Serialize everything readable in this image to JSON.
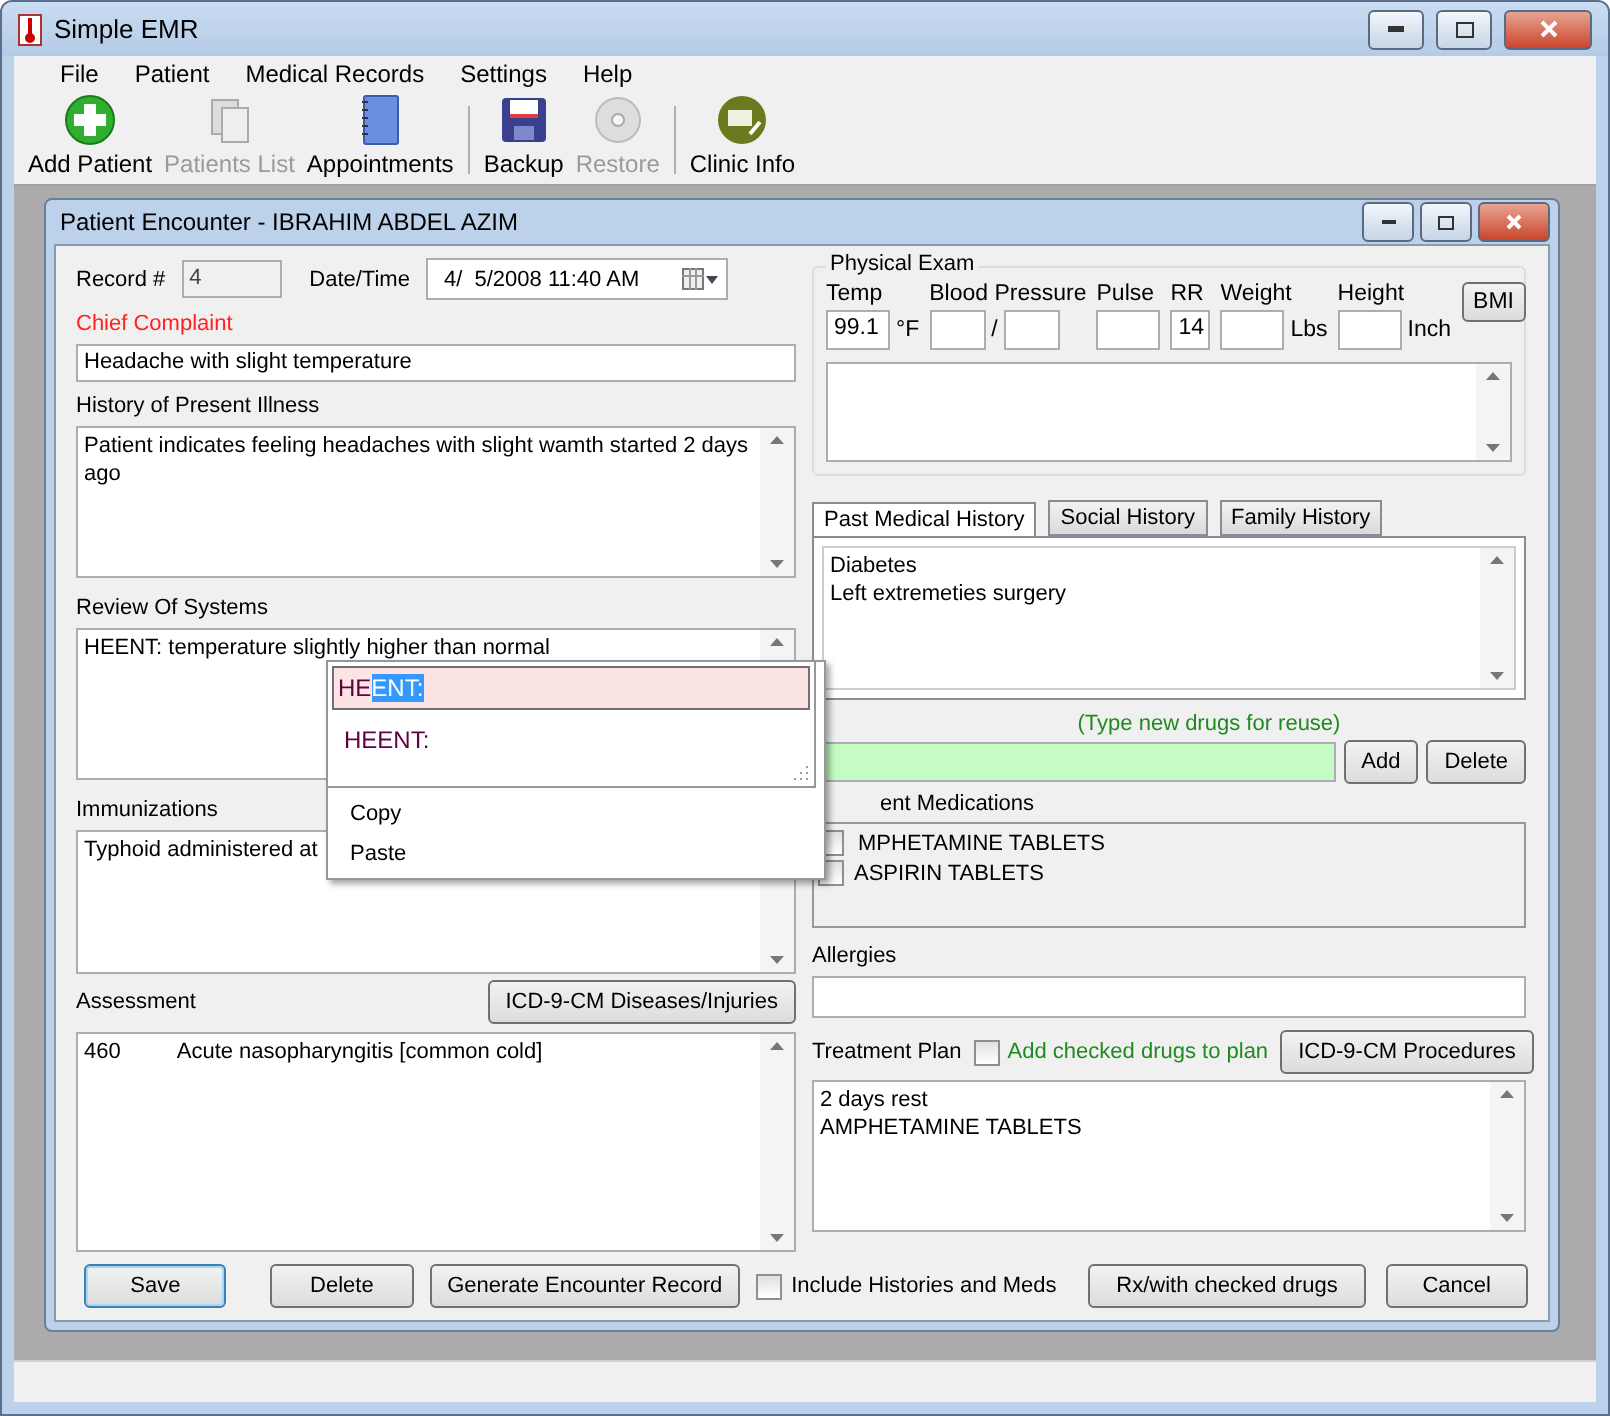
{
  "window": {
    "title": "Simple EMR"
  },
  "menu": [
    "File",
    "Patient",
    "Medical Records",
    "Settings",
    "Help"
  ],
  "toolbar": {
    "groups": [
      {
        "buttons": [
          {
            "label": "Add Patient",
            "kind": "add",
            "disabled": false
          },
          {
            "label": "Patients List",
            "kind": "list",
            "disabled": true
          },
          {
            "label": "Appointments",
            "kind": "notebook",
            "disabled": false
          }
        ]
      },
      {
        "buttons": [
          {
            "label": "Backup",
            "kind": "disk",
            "disabled": false
          },
          {
            "label": "Restore",
            "kind": "disc",
            "disabled": true
          }
        ]
      },
      {
        "buttons": [
          {
            "label": "Clinic Info",
            "kind": "clinic",
            "disabled": false
          }
        ]
      }
    ]
  },
  "encounter": {
    "title": "Patient Encounter - IBRAHIM ABDEL AZIM",
    "record": {
      "label": "Record #",
      "value": "4"
    },
    "datetime": {
      "label": "Date/Time",
      "value": "4/  5/2008 11:40 AM"
    },
    "chief_complaint": {
      "label": "Chief Complaint",
      "value": "Headache with slight temperature"
    },
    "history": {
      "label": "History of Present Illness",
      "value": "Patient indicates feeling headaches with slight wamth started 2 days ago"
    },
    "review": {
      "label": "Review Of Systems",
      "value": "HEENT: temperature slightly higher than normal"
    },
    "immunizations": {
      "label": "Immunizations",
      "value": "Typhoid administered at"
    },
    "assessment": {
      "label": "Assessment",
      "button": "ICD-9-CM Diseases/Injuries",
      "code": "460",
      "description": "Acute nasopharyngitis [common cold]"
    },
    "physical_exam": {
      "title": "Physical Exam",
      "button": "BMI",
      "vitals": [
        {
          "label": "Temp",
          "kind": "single",
          "value": "99.1",
          "unit": "°F"
        },
        {
          "label": "Blood Pressure",
          "kind": "pair",
          "separator": "/"
        },
        {
          "label": "Pulse",
          "kind": "single"
        },
        {
          "label": "RR",
          "kind": "single",
          "value": "14"
        },
        {
          "label": "Weight",
          "kind": "single",
          "unit": "Lbs"
        },
        {
          "label": "Height",
          "kind": "single",
          "unit": "Inch"
        }
      ]
    },
    "history_tabs": [
      {
        "label": "Past Medical History",
        "selected": true
      },
      {
        "label": "Social History",
        "selected": false
      },
      {
        "label": "Family History",
        "selected": false
      }
    ],
    "history_lines": [
      "Diabetes",
      "Left extremeties surgery"
    ],
    "drugs": {
      "hint": "(Type new drugs for reuse)",
      "add": "Add",
      "delete": "Delete"
    },
    "medications": {
      "label": "ent Medications",
      "items": [
        {
          "name": "MPHETAMINE TABLETS",
          "checked": false
        },
        {
          "name": "ASPIRIN TABLETS",
          "checked": false
        }
      ]
    },
    "allergies": {
      "label": "Allergies"
    },
    "treatment": {
      "label": "Treatment Plan",
      "option": {
        "label": "Add checked drugs to plan",
        "checked": false
      },
      "button": "ICD-9-CM Procedures",
      "lines": [
        "2 days rest",
        "AMPHETAMINE TABLETS"
      ]
    },
    "actions": {
      "save": "Save",
      "delete": "Delete",
      "generate": "Generate Encounter Record",
      "include": {
        "label": "Include Histories and Meds",
        "checked": false
      },
      "rx": "Rx/with checked drugs",
      "cancel": "Cancel"
    },
    "context_menu": [
      "Copy",
      "Paste"
    ],
    "autocomplete": {
      "typed": "HE",
      "selected_text": "ENT:",
      "items": [
        "HEENT:"
      ]
    }
  }
}
